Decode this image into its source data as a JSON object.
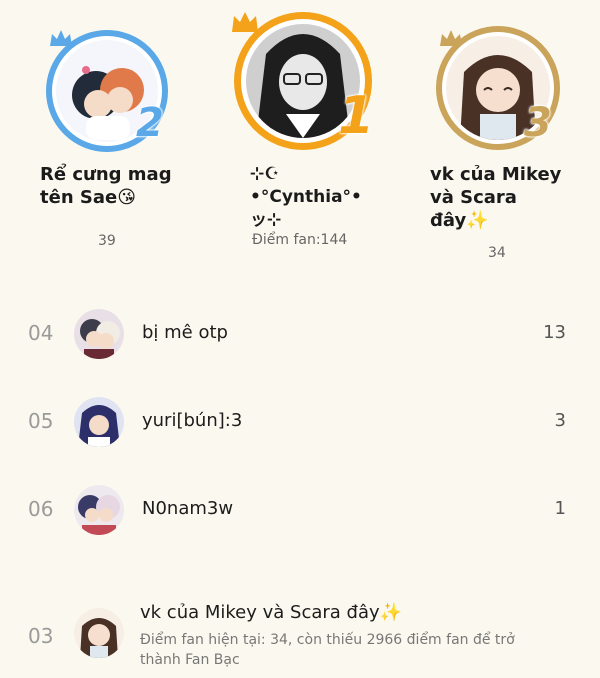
{
  "podium": {
    "first": {
      "rank": "1",
      "name": "⊹☪ •°Cynthia°• ッ⊹",
      "score": "Điểm fan:144"
    },
    "second": {
      "rank": "2",
      "name": "Rể cưng mag tên Sae😘",
      "score": "39"
    },
    "third": {
      "rank": "3",
      "name": "vk của Mikey và Scara đây✨",
      "score": "34"
    }
  },
  "list": [
    {
      "rank": "04",
      "name": "bị mê otp",
      "score": "13"
    },
    {
      "rank": "05",
      "name": "yuri[bún]:3",
      "score": "3"
    },
    {
      "rank": "06",
      "name": "N0nam3w",
      "score": "1"
    }
  ],
  "current_user": {
    "rank": "03",
    "name": "vk của Mikey và Scara đây✨",
    "status": "Điểm fan hiện tại: 34, còn thiếu 2966 điểm fan để trở thành Fan Bạc"
  },
  "colors": {
    "gold": "#f4a21a",
    "silver": "#5aa8e8",
    "bronze": "#c9a45a",
    "background": "#fbf9ef"
  },
  "icons": {
    "crown": "crown-icon"
  }
}
